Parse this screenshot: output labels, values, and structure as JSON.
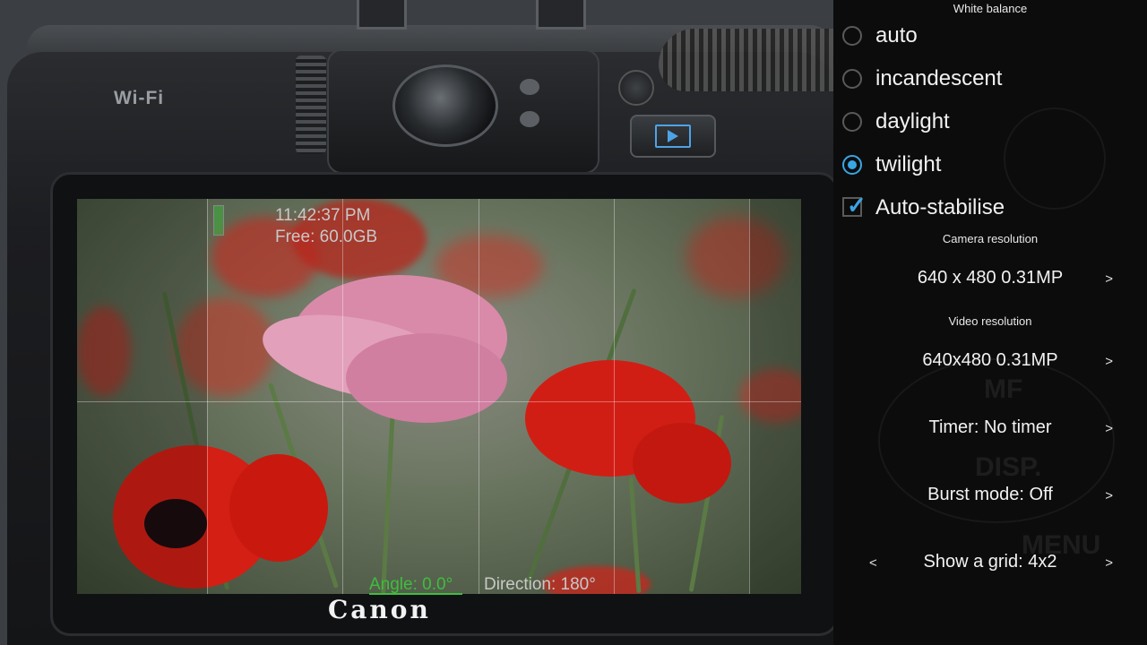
{
  "camera": {
    "wifi_label": "Wi-Fi",
    "brand": "Canon"
  },
  "preview": {
    "time": "11:42:37 PM",
    "free_space": "Free: 60.0GB",
    "angle": "Angle: 0.0°",
    "direction": "Direction: 180°"
  },
  "settings": {
    "white_balance_title": "White balance",
    "white_balance_options": [
      {
        "label": "auto",
        "selected": false
      },
      {
        "label": "incandescent",
        "selected": false
      },
      {
        "label": "daylight",
        "selected": false
      },
      {
        "label": "twilight",
        "selected": true
      }
    ],
    "auto_stabilise": {
      "label": "Auto-stabilise",
      "checked": true
    },
    "camera_resolution_title": "Camera resolution",
    "camera_resolution_value": "640 x 480 0.31MP",
    "video_resolution_title": "Video resolution",
    "video_resolution_value": "640x480 0.31MP",
    "timer_value": "Timer: No timer",
    "burst_value": "Burst mode: Off",
    "grid_value": "Show a grid: 4x2",
    "arrow_next": ">",
    "arrow_prev": "<"
  },
  "colors": {
    "accent": "#3aa5e4",
    "angle_ok": "#3fbd3f",
    "panel_bg": "#0c0c0d"
  }
}
